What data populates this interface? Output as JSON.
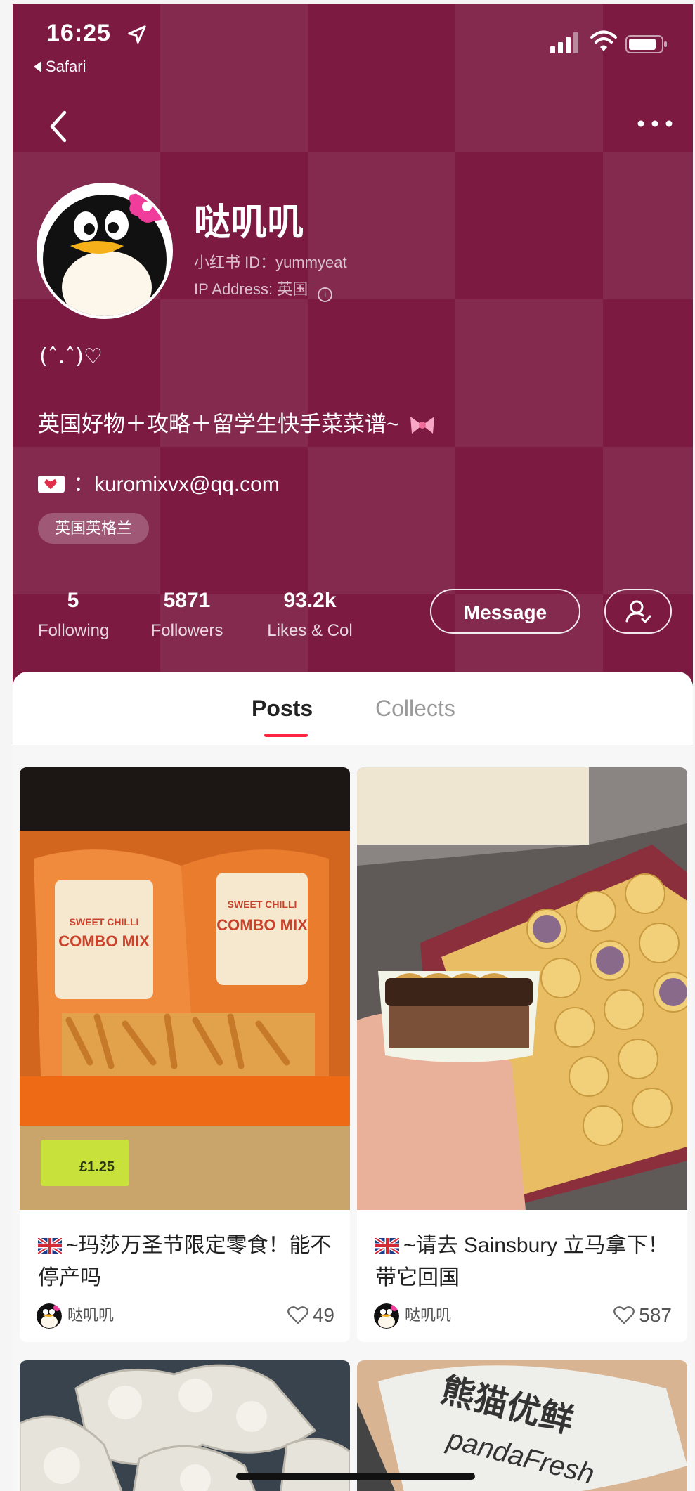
{
  "status_bar": {
    "time": "16:25",
    "back_app": "Safari"
  },
  "profile": {
    "name": "哒叽叽",
    "red_id": "小红书 ID：yummyeat",
    "ip_address": "IP Address: 英国",
    "kaomoji": "(ˆ.ˆ)♡",
    "bio": "英国好物＋攻略＋留学生快手菜菜谱~",
    "email_sep": "：",
    "email": "kuromixvx@qq.com",
    "location_tag": "英国英格兰"
  },
  "stats": [
    {
      "value": "5",
      "label": "Following"
    },
    {
      "value": "5871",
      "label": "Followers"
    },
    {
      "value": "93.2k",
      "label": "Likes & Col"
    }
  ],
  "actions": {
    "message": "Message"
  },
  "tabs": [
    {
      "label": "Posts",
      "active": true
    },
    {
      "label": "Collects",
      "active": false
    }
  ],
  "posts": [
    {
      "title": "~玛莎万圣节限定零食！能不停产吗",
      "author": "哒叽叽",
      "likes": "49",
      "image_text": [
        "SWEET CHILLI",
        "COMBO MIX"
      ],
      "price": "£1.25"
    },
    {
      "title": "~请去 Sainsbury 立马拿下！带它回国",
      "author": "哒叽叽",
      "likes": "587"
    },
    {
      "title": "",
      "author": "",
      "likes": ""
    },
    {
      "title": "",
      "author": "",
      "likes": "",
      "image_text": [
        "熊猫优鲜",
        "pandaFresh"
      ]
    }
  ],
  "colors": {
    "header_bg": "#7c1a42",
    "accent": "#ff2442"
  }
}
